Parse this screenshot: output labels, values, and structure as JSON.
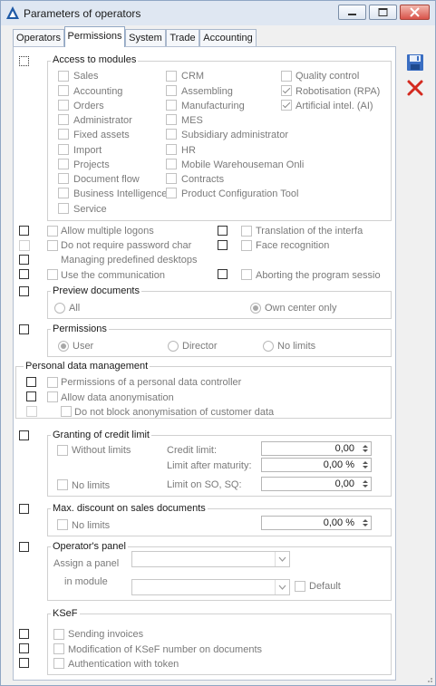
{
  "window": {
    "title": "Parameters of operators"
  },
  "tabs": [
    {
      "label": "Operators"
    },
    {
      "label": "Permissions"
    },
    {
      "label": "System"
    },
    {
      "label": "Trade"
    },
    {
      "label": "Accounting"
    }
  ],
  "active_tab": "Permissions",
  "toolbar": {
    "save_icon": "floppy-save-icon",
    "cancel_icon": "red-x-cancel-icon"
  },
  "access_to_modules": {
    "title": "Access to modules",
    "col1": [
      {
        "label": "Sales",
        "checked": false
      },
      {
        "label": "Accounting",
        "checked": false
      },
      {
        "label": "Orders",
        "checked": false
      },
      {
        "label": "Administrator",
        "checked": false
      },
      {
        "label": "Fixed assets",
        "checked": false
      },
      {
        "label": "Import",
        "checked": false
      },
      {
        "label": "Projects",
        "checked": false
      },
      {
        "label": "Document flow",
        "checked": false
      },
      {
        "label": "Business Intelligence",
        "checked": false
      },
      {
        "label": "Service",
        "checked": false
      }
    ],
    "col2": [
      {
        "label": "CRM",
        "checked": false
      },
      {
        "label": "Assembling",
        "checked": false
      },
      {
        "label": "Manufacturing",
        "checked": false
      },
      {
        "label": "MES",
        "checked": false
      },
      {
        "label": "Subsidiary administrator",
        "checked": false
      },
      {
        "label": "HR",
        "checked": false
      },
      {
        "label": "Mobile Warehouseman Onli",
        "checked": false
      },
      {
        "label": "Contracts",
        "checked": false
      },
      {
        "label": "Product Configuration Tool",
        "checked": false
      }
    ],
    "col3": [
      {
        "label": "Quality control",
        "checked": false
      },
      {
        "label": "Robotisation (RPA)",
        "checked": true
      },
      {
        "label": "Artificial intel. (AI)",
        "checked": true
      }
    ]
  },
  "options": {
    "allow_multiple_logons": "Allow multiple logons",
    "no_password_chars": "Do not require password char",
    "managing_desktops": "Managing predefined desktops",
    "use_communication": "Use the communication",
    "translation": "Translation of the interfa",
    "face_recognition": "Face recognition",
    "aborting_session": "Aborting the program sessio"
  },
  "preview_documents": {
    "title": "Preview documents",
    "all": "All",
    "own_center": "Own center only",
    "selected": "Own center only"
  },
  "permissions": {
    "title": "Permissions",
    "user": "User",
    "director": "Director",
    "no_limits": "No limits",
    "selected": "User"
  },
  "personal_data": {
    "title": "Personal data management",
    "controller": "Permissions of a personal data controller",
    "anonymisation": "Allow data anonymisation",
    "no_block": "Do not block anonymisation of customer data"
  },
  "credit_limit": {
    "title": "Granting of credit limit",
    "without_limits": "Without limits",
    "no_limits": "No limits",
    "credit_limit_label": "Credit limit:",
    "credit_limit_value": "0,00",
    "after_maturity_label": "Limit after maturity:",
    "after_maturity_value": "0,00 %",
    "limit_so_sq_label": "Limit on SO, SQ:",
    "limit_so_sq_value": "0,00"
  },
  "max_discount": {
    "title": "Max. discount on sales documents",
    "no_limits": "No limits",
    "value": "0,00 %"
  },
  "operator_panel": {
    "title": "Operator's panel",
    "assign_label": "Assign a panel",
    "module_label": "in module",
    "default_label": "Default",
    "assign_value": "",
    "module_value": ""
  },
  "ksef": {
    "title": "KSeF",
    "sending_invoices": "Sending invoices",
    "modification": "Modification of KSeF number on documents",
    "authentication": "Authentication with token"
  }
}
